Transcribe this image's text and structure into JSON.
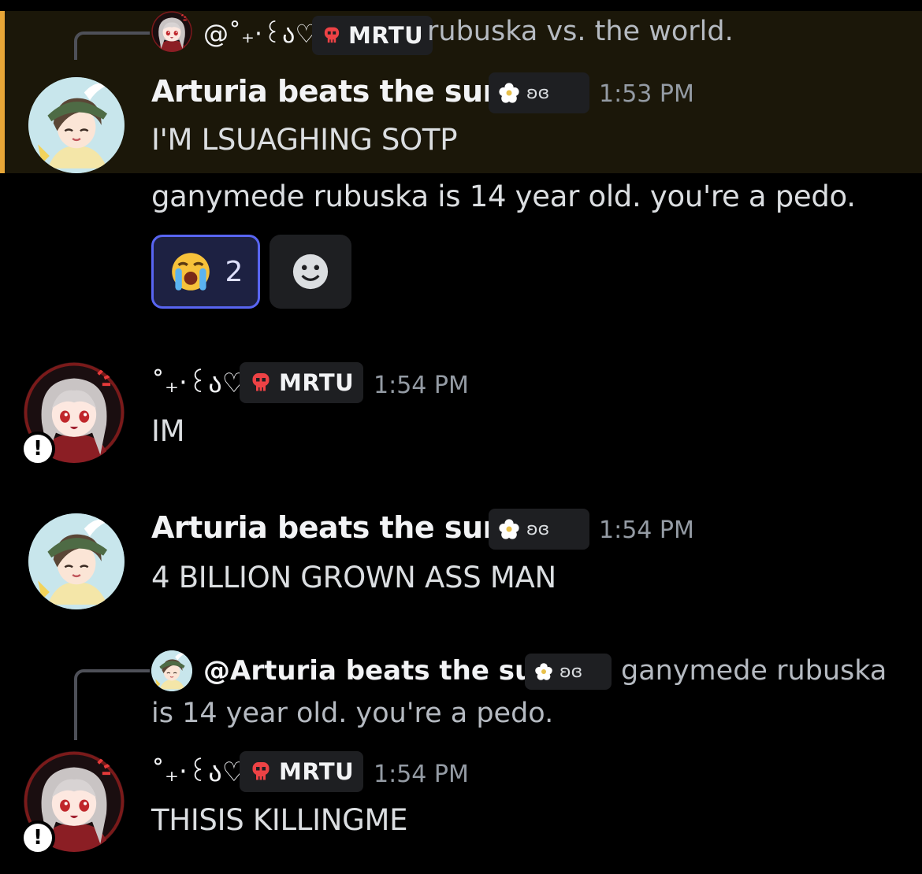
{
  "messages": [
    {
      "reply": {
        "author": "@˚₊‧꒰ა♡",
        "role_tag": "MRTU",
        "text": "rubuska vs. the world."
      },
      "author": "Arturia beats the sun",
      "badge": "ʚɞ",
      "timestamp": "1:53 PM",
      "lines": [
        "I'M LSUAGHING SOTP"
      ]
    },
    {
      "continuation": true,
      "lines": [
        "ganymede rubuska is 14 year old. you're a pedo."
      ],
      "reactions": [
        {
          "emoji": "😭",
          "count": "2",
          "selected": true
        }
      ]
    },
    {
      "author": "˚₊‧꒰ა♡",
      "role_tag": "MRTU",
      "timestamp": "1:54 PM",
      "lines": [
        "IM"
      ]
    },
    {
      "author": "Arturia beats the sun",
      "badge": "ʚɞ",
      "timestamp": "1:54 PM",
      "lines": [
        "4 BILLION GROWN ASS MAN"
      ]
    },
    {
      "reply": {
        "author": "@Arturia beats the sun",
        "badge": "ʚɞ",
        "text_line1": "ganymede rubuska",
        "text_line2": "is 14 year old. you're a pedo."
      },
      "author": "˚₊‧꒰ა♡",
      "role_tag": "MRTU",
      "timestamp": "1:54 PM",
      "lines": [
        "THISIS KILLINGME"
      ]
    }
  ],
  "colors": {
    "mention_bg": "#1b1709",
    "mention_bar": "#e7a637",
    "reaction_border": "#5865f2",
    "skull_tag": "#ed4245"
  },
  "icons": [
    "skull-icon",
    "flower-icon",
    "add-reaction-icon",
    "warning-icon",
    "loudly-crying-icon"
  ]
}
